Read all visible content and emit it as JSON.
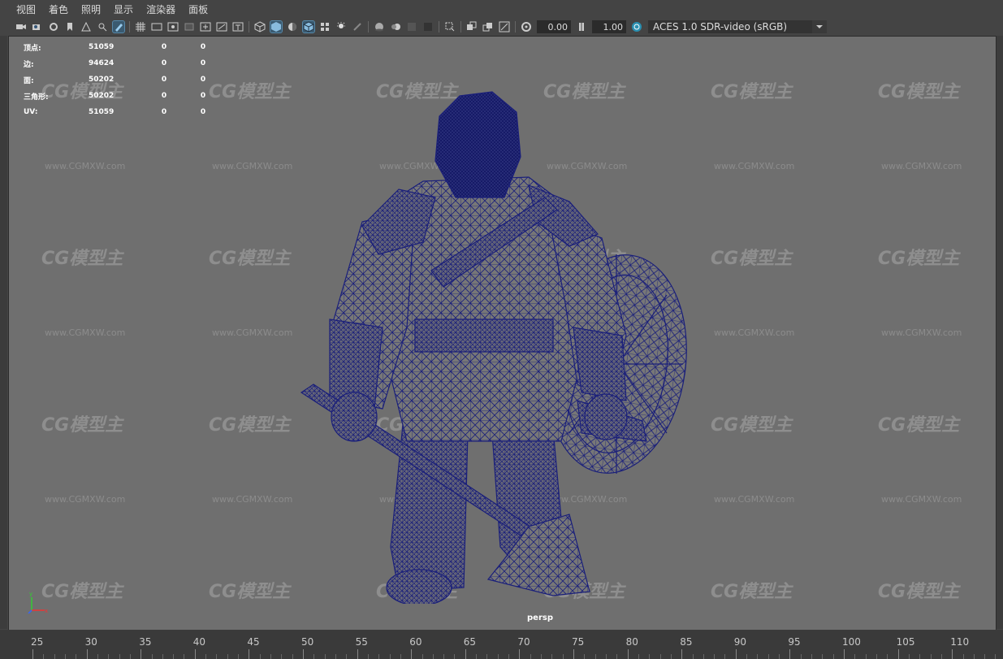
{
  "menu": [
    "视图",
    "着色",
    "照明",
    "显示",
    "渲染器",
    "面板"
  ],
  "toolbar": {
    "exposure_value": "0.00",
    "gamma_value": "1.00",
    "color_space": "ACES 1.0 SDR-video (sRGB)"
  },
  "hud": {
    "rows": [
      {
        "label": "顶点:",
        "v1": "51059",
        "v2": "0",
        "v3": "0"
      },
      {
        "label": "边:",
        "v1": "94624",
        "v2": "0",
        "v3": "0"
      },
      {
        "label": "面:",
        "v1": "50202",
        "v2": "0",
        "v3": "0"
      },
      {
        "label": "三角形:",
        "v1": "50202",
        "v2": "0",
        "v3": "0"
      },
      {
        "label": "UV:",
        "v1": "51059",
        "v2": "0",
        "v3": "0"
      }
    ]
  },
  "camera_label": "persp",
  "watermark": {
    "logo": "CG模型主",
    "url": "www.CGMXW.com"
  },
  "timeline": {
    "ticks": [
      "25",
      "30",
      "35",
      "40",
      "45",
      "50",
      "55",
      "60",
      "65",
      "70",
      "75",
      "80",
      "85",
      "90",
      "95",
      "100",
      "105",
      "110"
    ]
  },
  "colors": {
    "wire": "#1a1f7a",
    "viewport_bg": "#6f6f6f",
    "accent": "#58a"
  }
}
